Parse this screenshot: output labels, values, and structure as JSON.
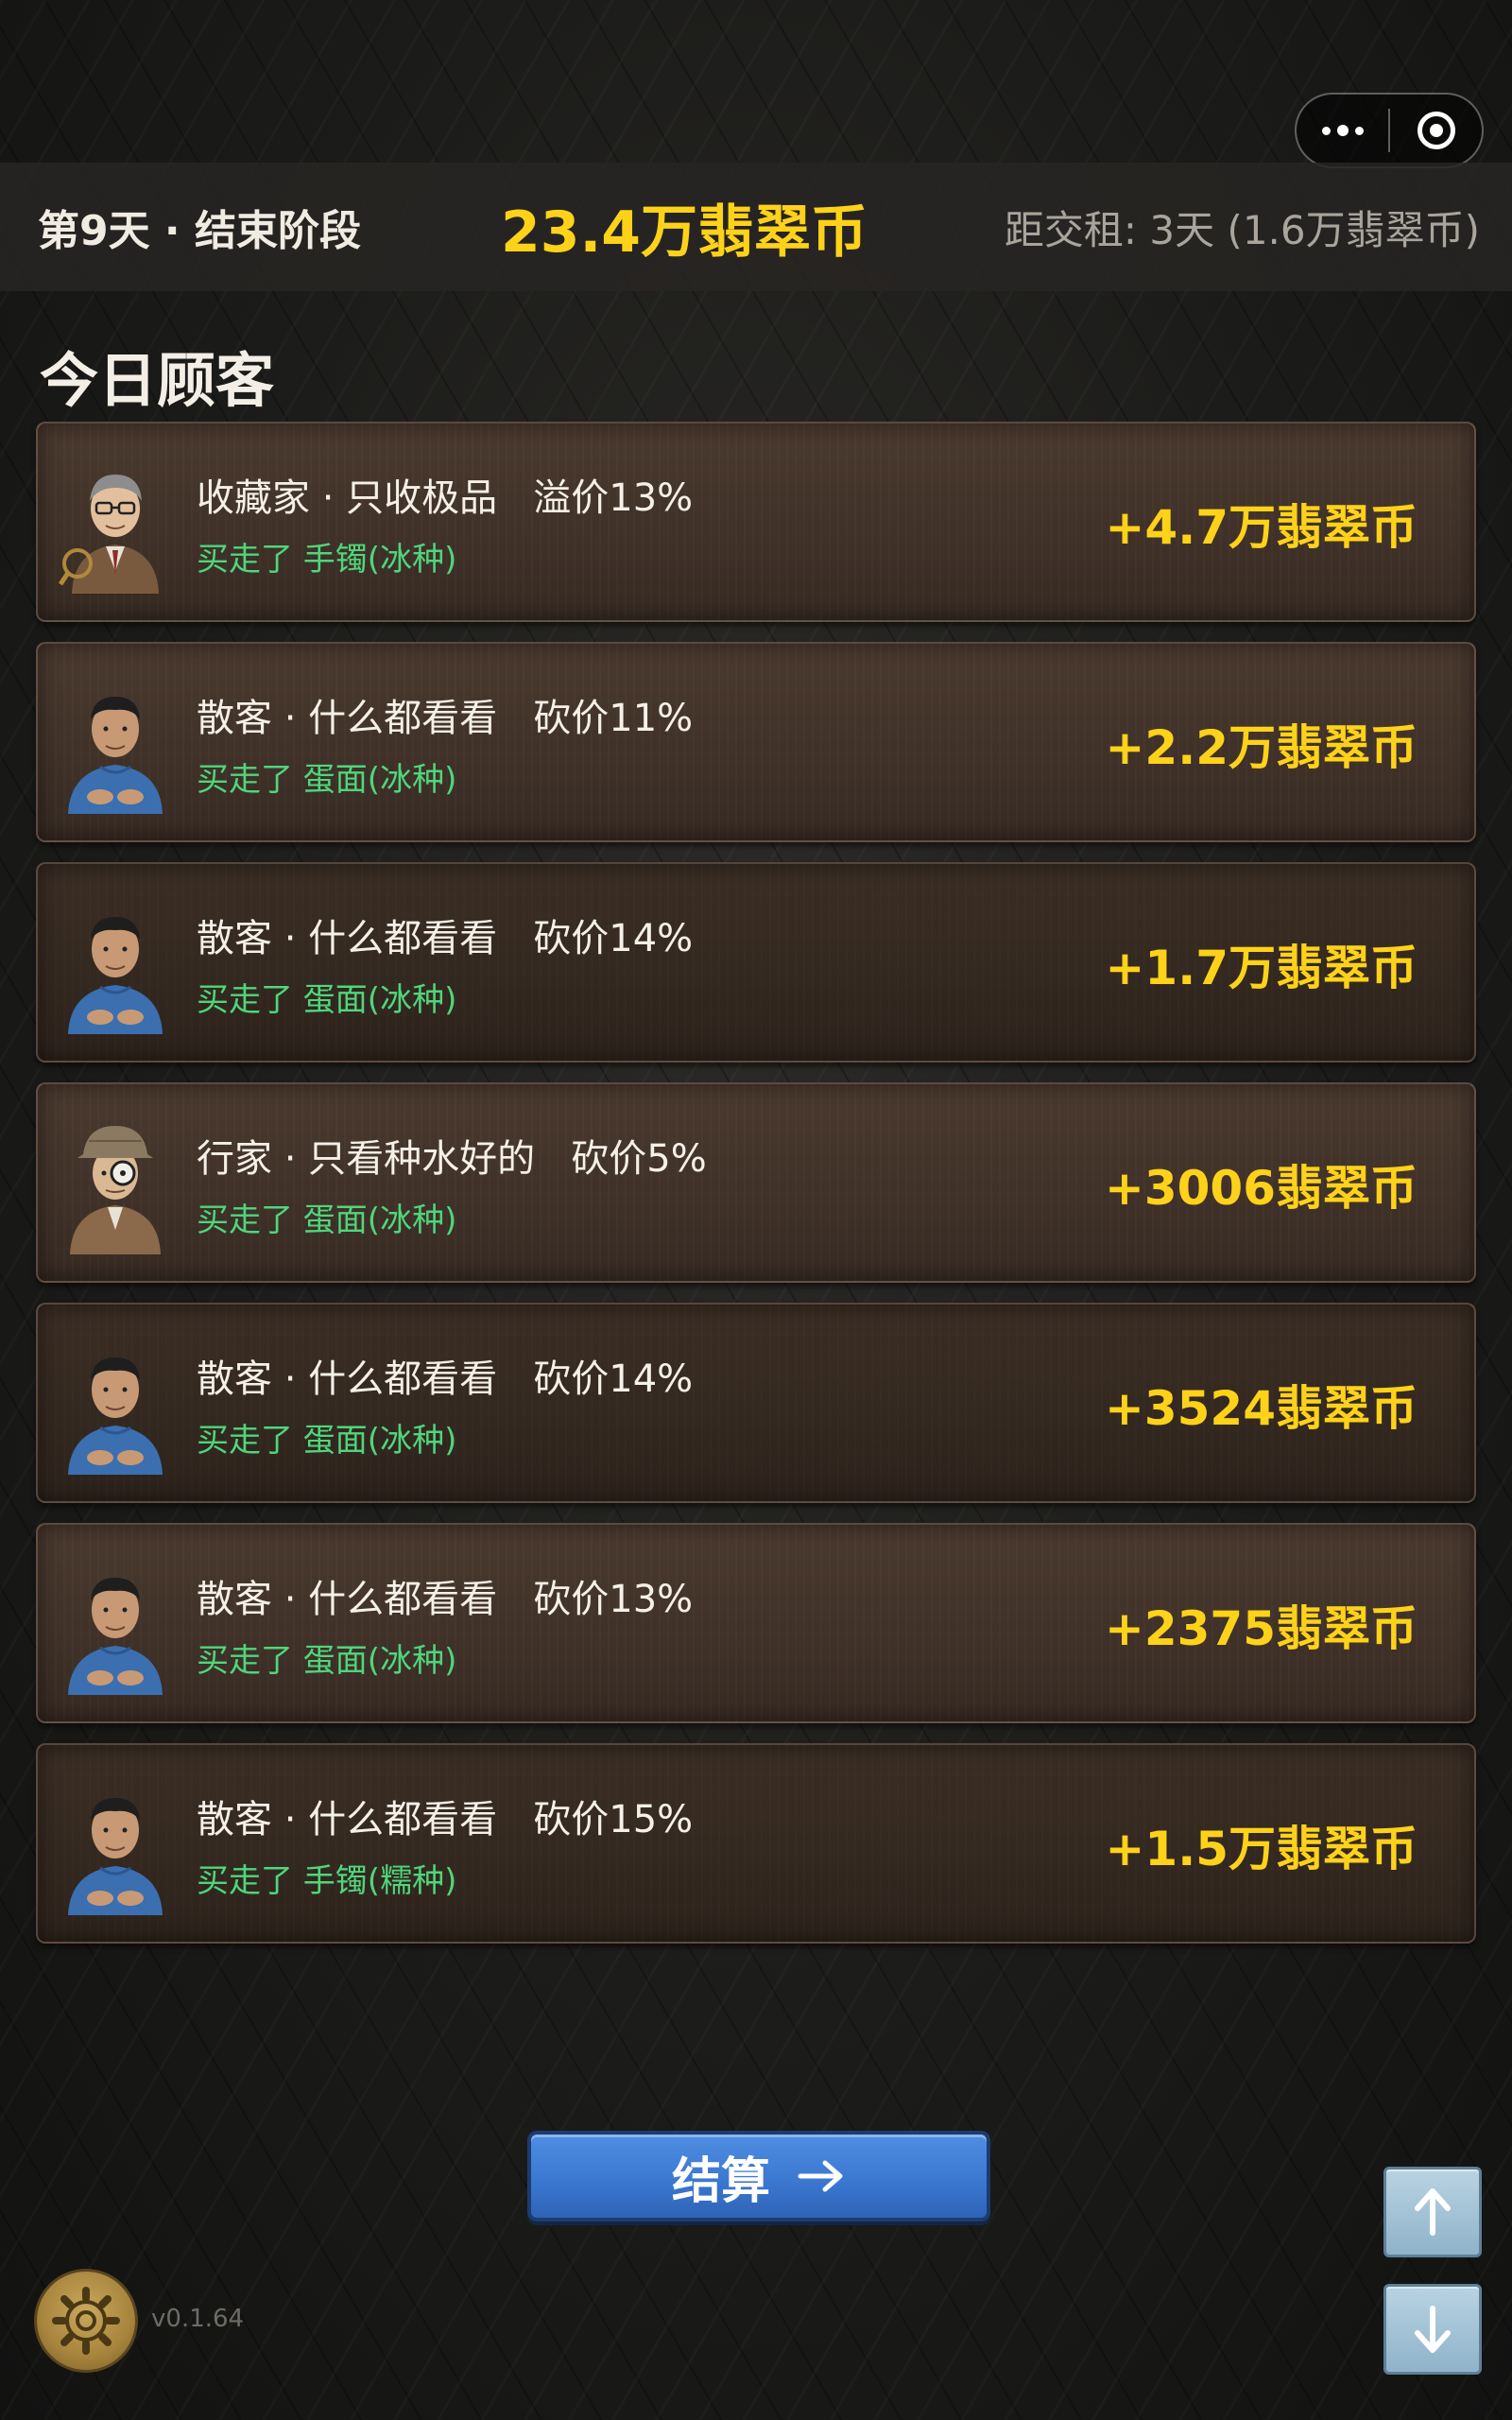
{
  "header": {
    "day_label": "第9天 · 结束阶段",
    "coins_total": "23.4万翡翠币",
    "rent_info": "距交租: 3天 (1.6万翡翠币)"
  },
  "section_title": "今日顾客",
  "customers": [
    {
      "avatar": "collector-portrait-icon",
      "name": "收藏家 · 只收极品   溢价13%",
      "bought": "买走了 手镯(冰种)",
      "amount": "+4.7万翡翠币"
    },
    {
      "avatar": "casual-customer-portrait-icon",
      "name": "散客 · 什么都看看   砍价11%",
      "bought": "买走了 蛋面(冰种)",
      "amount": "+2.2万翡翠币"
    },
    {
      "avatar": "casual-customer-portrait-icon",
      "name": "散客 · 什么都看看   砍价14%",
      "bought": "买走了 蛋面(冰种)",
      "amount": "+1.7万翡翠币"
    },
    {
      "avatar": "expert-portrait-icon",
      "name": "行家 · 只看种水好的   砍价5%",
      "bought": "买走了 蛋面(冰种)",
      "amount": "+3006翡翠币"
    },
    {
      "avatar": "casual-customer-portrait-icon",
      "name": "散客 · 什么都看看   砍价14%",
      "bought": "买走了 蛋面(冰种)",
      "amount": "+3524翡翠币"
    },
    {
      "avatar": "casual-customer-portrait-icon",
      "name": "散客 · 什么都看看   砍价13%",
      "bought": "买走了 蛋面(冰种)",
      "amount": "+2375翡翠币"
    },
    {
      "avatar": "casual-customer-portrait-icon",
      "name": "散客 · 什么都看看   砍价15%",
      "bought": "买走了 手镯(糯种)",
      "amount": "+1.5万翡翠币"
    }
  ],
  "settle_button": {
    "label": "结算",
    "icon": "arrow-right-icon"
  },
  "scroll": {
    "up_icon": "arrow-up-icon",
    "down_icon": "arrow-down-icon"
  },
  "settings_icon": "gear-icon",
  "version": "v0.1.64",
  "colors": {
    "gold": "#ffd21a",
    "green": "#4fd67c",
    "button_blue": "#3a76cf",
    "card_brown": "#3f3128"
  }
}
